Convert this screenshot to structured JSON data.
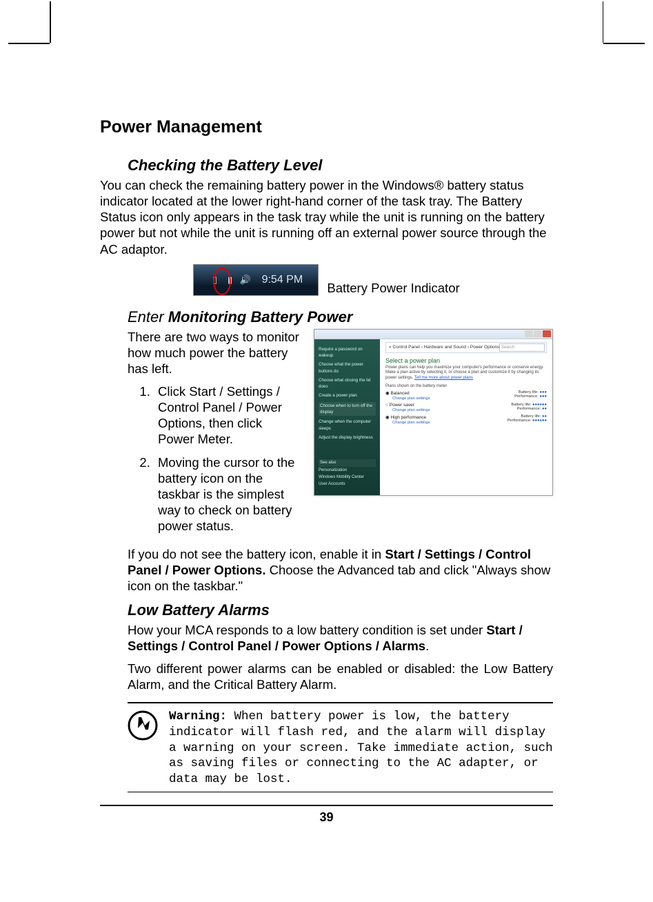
{
  "heading": "Power Management",
  "section1": {
    "title": "Checking the Battery Level",
    "para": "You can check the remaining battery power in the Windows® battery status indicator located at the lower right-hand corner of the task tray. The Battery Status icon only appears in the task tray while the unit is running on the battery power but not while the unit is running off an external power source through the AC adaptor.",
    "tray_time": "9:54 PM",
    "caption": "Battery Power Indicator"
  },
  "section2": {
    "prefix": "Enter ",
    "title": "Monitoring Battery Power",
    "intro": "There are two ways to monitor how much power the battery has left.",
    "steps": [
      "Click Start / Settings / Control Panel / Power Options, then click Power Meter.",
      "Moving the cursor to the battery icon on the taskbar is the simplest way to check on battery power status."
    ],
    "screenshot": {
      "breadcrumb": "« Control Panel  ›  Hardware and Sound  ›  Power Options",
      "search_placeholder": "Search",
      "sidebar": [
        "Require a password on wakeup",
        "Choose what the power buttons do",
        "Choose what closing the lid does",
        "Create a power plan",
        "Choose when to turn off the display",
        "Change when the computer sleeps",
        "Adjust the display brightness"
      ],
      "seealso_title": "See also",
      "seealso": [
        "Personalization",
        "Windows Mobility Center",
        "User Accounts"
      ],
      "main_title": "Select a power plan",
      "main_desc": "Power plans can help you maximize your computer's performance or conserve energy. Make a plan active by selecting it, or choose a plan and customize it by changing its power settings.",
      "tell_more": "Tell me more about power plans",
      "plans_label": "Plans shown on the battery meter",
      "plans": [
        {
          "name": "Balanced",
          "life": "●●●",
          "perf": "●●●"
        },
        {
          "name": "Power saver",
          "life": "●●●●●●",
          "perf": "●●"
        },
        {
          "name": "High performance",
          "life": "●●",
          "perf": "●●●●●●"
        }
      ],
      "change": "Change plan settings",
      "battlife": "Battery life:",
      "performance": "Performance:"
    },
    "note_pre": "If you do not see the battery icon, enable it in ",
    "note_bold1": "Start / Settings / Control Panel / Power Options.",
    "note_post": " Choose the Advanced tab and click \"Always show icon on the taskbar.\""
  },
  "section3": {
    "title": "Low Battery Alarms",
    "p1_pre": "How your MCA responds to a low battery condition is set under ",
    "p1_bold": "Start / Settings / Control Panel / Power Options / Alarms",
    "p1_post": ".",
    "p2": "Two different power alarms can be enabled or disabled: the Low Battery Alarm, and the Critical Battery Alarm.",
    "warn_label": "Warning:",
    "warn_text": " When battery power is low, the battery indicator will flash red, and the alarm will display a warning on your screen. Take immediate action, such as saving files or connecting to the AC adapter, or data may be lost."
  },
  "page_number": "39"
}
